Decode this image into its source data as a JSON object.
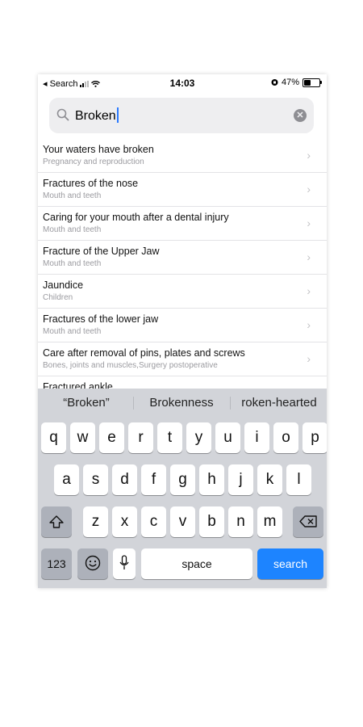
{
  "status_bar": {
    "back_app": "◂ Search",
    "time": "14:03",
    "battery": "47%",
    "battery_level": 0.47
  },
  "search": {
    "query": "Broken"
  },
  "results": [
    {
      "title": "Your waters have broken",
      "subtitle": "Pregnancy and reproduction"
    },
    {
      "title": "Fractures of the nose",
      "subtitle": "Mouth and teeth"
    },
    {
      "title": "Caring for your mouth after a dental injury",
      "subtitle": "Mouth and teeth"
    },
    {
      "title": "Fracture of the Upper Jaw",
      "subtitle": "Mouth and teeth"
    },
    {
      "title": "Jaundice",
      "subtitle": "Children"
    },
    {
      "title": "Fractures of the lower jaw",
      "subtitle": "Mouth and teeth"
    },
    {
      "title": "Care after removal of pins, plates and screws",
      "subtitle": "Bones, joints and muscles,Surgery  postoperative"
    },
    {
      "title": "Fractured ankle",
      "subtitle": ""
    }
  ],
  "keyboard": {
    "suggestions": [
      "“Broken”",
      "Brokenness",
      "roken-hearted"
    ],
    "row1": [
      "q",
      "w",
      "e",
      "r",
      "t",
      "y",
      "u",
      "i",
      "o",
      "p"
    ],
    "row2": [
      "a",
      "s",
      "d",
      "f",
      "g",
      "h",
      "j",
      "k",
      "l"
    ],
    "row3": [
      "z",
      "x",
      "c",
      "v",
      "b",
      "n",
      "m"
    ],
    "numbers_label": "123",
    "space_label": "space",
    "search_label": "search"
  },
  "icons": [
    "search-icon",
    "clear-icon",
    "chevron-right-icon",
    "shift-icon",
    "backspace-icon",
    "emoji-icon",
    "microphone-icon",
    "wifi-icon",
    "battery-icon",
    "lock-icon"
  ]
}
